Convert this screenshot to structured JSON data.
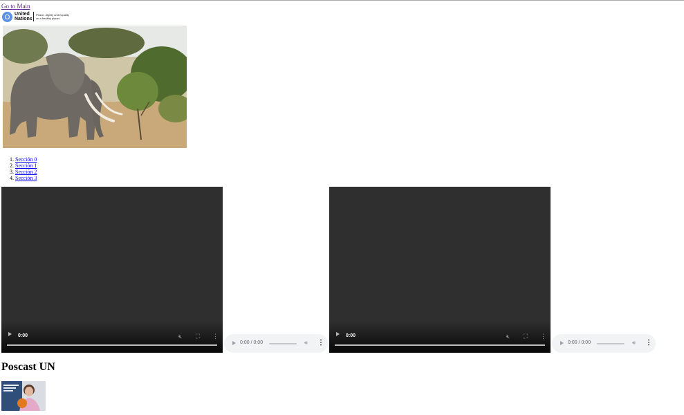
{
  "header": {
    "skip_link": "Go to Main",
    "logo": {
      "org_name_line1": "United",
      "org_name_line2": "Nations",
      "tagline_line1": "Peace, dignity and equality",
      "tagline_line2": "on a healthy planet",
      "emblem_icon": "un-emblem-icon"
    }
  },
  "hero_image": {
    "subject": "elephant",
    "icon": "elephant-photo"
  },
  "sections": {
    "items": [
      {
        "label": "Sección 0"
      },
      {
        "label": "Sección 1"
      },
      {
        "label": "Sección 2"
      },
      {
        "label": "Sección 3"
      }
    ]
  },
  "media": {
    "video_1": {
      "time": "0:00"
    },
    "audio_1": {
      "time": "0:00 / 0:00"
    },
    "video_2": {
      "time": "0:00"
    },
    "audio_2": {
      "time": "0:00 / 0:00"
    }
  },
  "podcast": {
    "title": "Poscast UN",
    "thumbnail_icon": "podcast-thumbnail"
  },
  "colors": {
    "link": "#0000ee",
    "visited_link": "#551a8b",
    "video_bg": "#2f2f2f",
    "audio_bg": "#f1f3f4"
  }
}
